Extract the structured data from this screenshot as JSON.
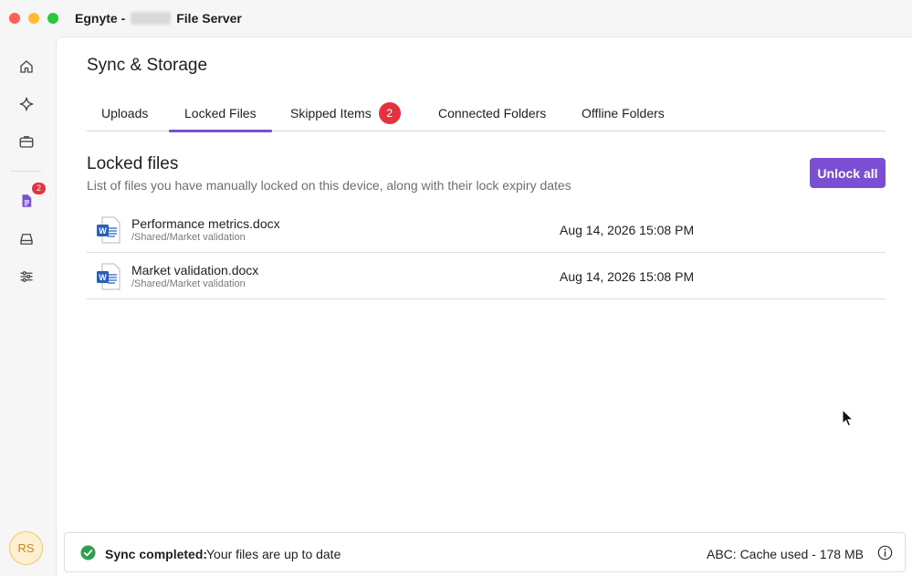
{
  "window": {
    "title_prefix": "Egnyte -",
    "title_suffix": "File Server"
  },
  "sidebar": {
    "items": [
      {
        "icon": "home-icon"
      },
      {
        "icon": "sparkle-icon"
      },
      {
        "icon": "briefcase-icon"
      },
      {
        "icon": "document-icon",
        "badge": "2"
      },
      {
        "icon": "drive-icon"
      },
      {
        "icon": "sliders-icon"
      }
    ],
    "avatar_initials": "RS"
  },
  "page": {
    "title": "Sync & Storage"
  },
  "tabs": [
    {
      "label": "Uploads",
      "active": false
    },
    {
      "label": "Locked Files",
      "active": true
    },
    {
      "label": "Skipped Items",
      "badge": "2",
      "active": false
    },
    {
      "label": "Connected Folders",
      "active": false
    },
    {
      "label": "Offline Folders",
      "active": false
    }
  ],
  "section": {
    "title": "Locked files",
    "subtitle": "List of files you have manually locked on this device, along with their lock expiry dates",
    "unlock_all_label": "Unlock all"
  },
  "files": [
    {
      "name": "Performance metrics.docx",
      "path": "/Shared/Market validation",
      "expiry": "Aug 14, 2026 15:08 PM",
      "icon": "word-document-icon"
    },
    {
      "name": "Market validation.docx",
      "path": "/Shared/Market validation",
      "expiry": "Aug 14, 2026 15:08 PM",
      "icon": "word-document-icon"
    }
  ],
  "status": {
    "bold": "Sync completed:",
    "text": "Your files are up to date",
    "cache": "ABC: Cache used - 178 MB"
  },
  "colors": {
    "accent": "#7b4fd3",
    "badge": "#e5323e",
    "success": "#2e9e4f"
  }
}
